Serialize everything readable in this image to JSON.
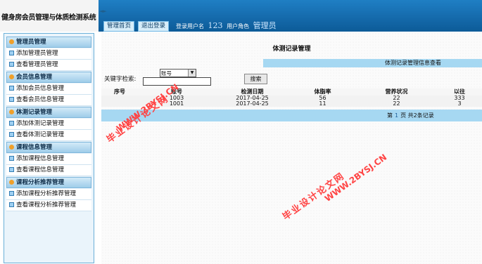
{
  "app": {
    "title": "健身房会员管理与体质检测系统"
  },
  "header": {
    "toggle_glyph": "◄►",
    "tabs": [
      {
        "label": "管理首页"
      },
      {
        "label": "退出登录"
      }
    ],
    "user_label": "登录用户名",
    "username": "123",
    "role_label": "用户角色",
    "role": "管理员"
  },
  "sidebar": {
    "sections": [
      {
        "title": "管理员管理",
        "items": [
          "添加管理员管理",
          "查看管理员管理"
        ]
      },
      {
        "title": "会员信息管理",
        "items": [
          "添加会员信息管理",
          "查看会员信息管理"
        ]
      },
      {
        "title": "体测记录管理",
        "items": [
          "添加体测记录管理",
          "查看体测记录管理"
        ]
      },
      {
        "title": "课程信息管理",
        "items": [
          "添加课程信息管理",
          "查看课程信息管理"
        ]
      },
      {
        "title": "课程分析推荐管理",
        "items": [
          "添加课程分析推荐管理",
          "查看课程分析推荐管理"
        ]
      }
    ]
  },
  "main": {
    "page_title": "体测记录管理",
    "subtitle": "体测记录管理信息查看",
    "search": {
      "label": "关键字检索:",
      "select_value": "账号",
      "button": "搜索"
    },
    "table": {
      "columns": [
        "序号",
        "账号",
        "检测日期",
        "体脂率",
        "营养状况",
        "以往"
      ],
      "rows": [
        [
          "",
          "1003",
          "2017-04-25",
          "56",
          "22",
          "333"
        ],
        [
          "",
          "1001",
          "2017-04-25",
          "11",
          "22",
          "3"
        ]
      ]
    },
    "pager": {
      "prefix": "第",
      "page": "1",
      "suffix": "页 共2条记录"
    }
  },
  "watermark": {
    "site": "WWW.2BYSJ.CN",
    "name": "毕业设计论文网",
    "color": "#ff4444"
  }
}
